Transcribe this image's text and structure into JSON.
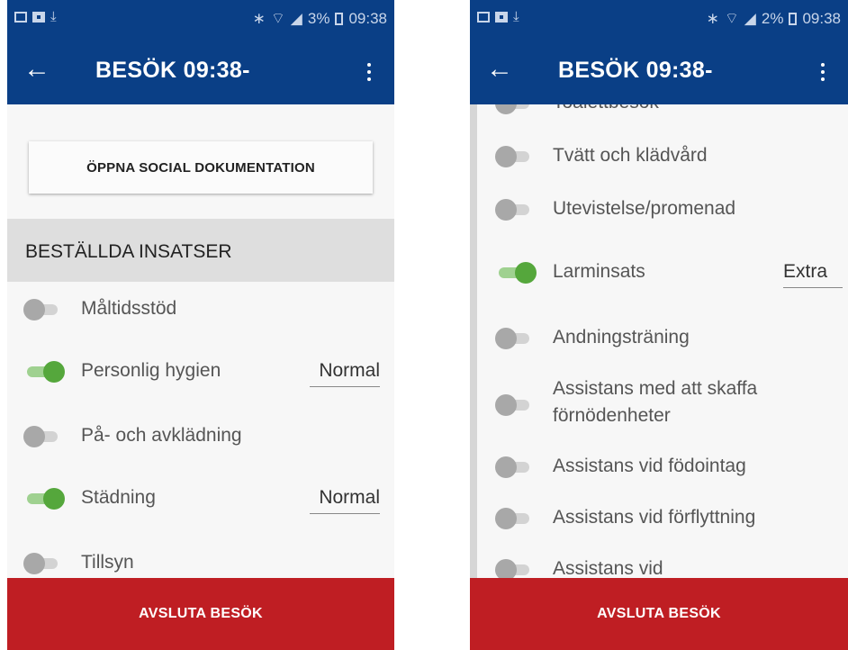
{
  "left": {
    "status": {
      "icons_left": [
        "image-icon",
        "pin-icon",
        "download-icon"
      ],
      "battery": "3%",
      "time": "09:38"
    },
    "appbar": {
      "title": "BESÖK 09:38-"
    },
    "doc_button": "ÖPPNA SOCIAL DOKUMENTATION",
    "section_header": "BESTÄLLDA INSATSER",
    "items": [
      {
        "label": "Måltidsstöd",
        "on": false,
        "value": ""
      },
      {
        "label": "Personlig hygien",
        "on": true,
        "value": "Normal"
      },
      {
        "label": "På- och avklädning",
        "on": false,
        "value": ""
      },
      {
        "label": "Städning",
        "on": true,
        "value": "Normal"
      },
      {
        "label": "Tillsyn",
        "on": false,
        "value": ""
      }
    ],
    "footer": "AVSLUTA BESÖK"
  },
  "right": {
    "status": {
      "battery": "2%",
      "time": "09:38"
    },
    "appbar": {
      "title": "BESÖK 09:38-"
    },
    "items": [
      {
        "label": "Toalettbesök",
        "on": false,
        "value": ""
      },
      {
        "label": "Tvätt och klädvård",
        "on": false,
        "value": ""
      },
      {
        "label": "Utevistelse/promenad",
        "on": false,
        "value": ""
      },
      {
        "label": "Larminsats",
        "on": true,
        "value": "Extra"
      },
      {
        "label": "Andningsträning",
        "on": false,
        "value": ""
      },
      {
        "label": "Assistans med att skaffa förnödenheter",
        "on": false,
        "value": ""
      },
      {
        "label": "Assistans vid födointag",
        "on": false,
        "value": ""
      },
      {
        "label": "Assistans vid förflyttning",
        "on": false,
        "value": ""
      },
      {
        "label": "Assistans vid",
        "on": false,
        "value": ""
      }
    ],
    "footer": "AVSLUTA BESÖK"
  },
  "colors": {
    "appbar": "#0a3f86",
    "toggle_on": "#55a73c",
    "footer": "#bf1e23"
  }
}
